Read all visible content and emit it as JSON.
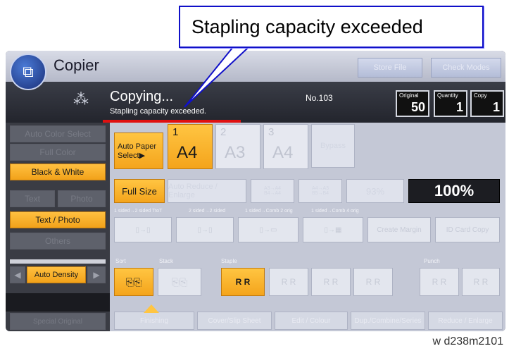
{
  "callout": {
    "text": "Stapling capacity exceeded"
  },
  "titlebar": {
    "app_name": "Copier",
    "store_file": "Store File",
    "check_modes": "Check Modes"
  },
  "status": {
    "main": "Copying...",
    "sub": "Stapling capacity exceeded.",
    "job_no": "No.103",
    "original_label": "Original",
    "original_value": "50",
    "quantity_label": "Quantity",
    "quantity_value": "1",
    "copy_label": "Copy",
    "copy_value": "1"
  },
  "color_modes": [
    "Auto Color Select",
    "Full Color",
    "Black & White"
  ],
  "original_types": {
    "text": "Text",
    "photo": "Photo",
    "text_photo": "Text / Photo",
    "others": "Others"
  },
  "density": {
    "label": "Auto Density",
    "left": "◀",
    "right": "▶"
  },
  "paper": {
    "auto_select": "Auto Paper Select▶",
    "trays": [
      {
        "num": "1",
        "size": "A4"
      },
      {
        "num": "2",
        "size": "A3"
      },
      {
        "num": "3",
        "size": "A4"
      }
    ],
    "bypass": "Bypass"
  },
  "reduce": {
    "full_size": "Full Size",
    "auto_reduce": "Auto Reduce / Enlarge",
    "r1": "A3→A4\nB4→A4",
    "r2": "A4→A3\nB5→B4",
    "pct_tile": "93%",
    "ratio": "100%"
  },
  "duplex": {
    "labels": [
      "1 sided→2 sided TtoT",
      "2 sided→2 sided",
      "1 sided→Comb 2 orig",
      "1 sided→Comb 4 orig"
    ],
    "create_margin": "Create Margin",
    "id_card": "ID Card Copy"
  },
  "finishing": {
    "sort": "Sort",
    "stack": "Stack",
    "staple": "Staple",
    "punch": "Punch"
  },
  "bottom_tabs": [
    "Finishing",
    "Cover/Slip Sheet",
    "Edit / Colour",
    "Dup./Combine/Series",
    "Reduce / Enlarge"
  ],
  "footer": {
    "special": "Special Original",
    "caption": "w d238m2101"
  },
  "colors": {
    "accent": "#f4a41c",
    "callout_border": "#1010c8",
    "underline": "#e01010"
  }
}
